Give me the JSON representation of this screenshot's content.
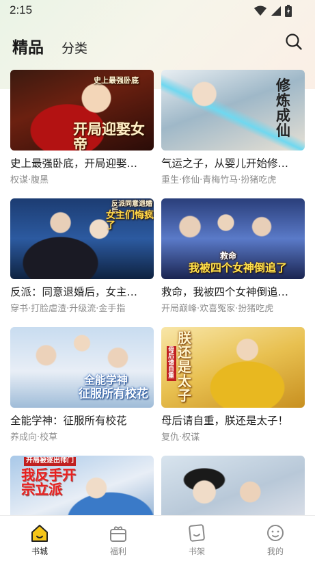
{
  "status_bar": {
    "time": "2:15"
  },
  "header": {
    "tab_active": "精品",
    "tab_inactive": "分类"
  },
  "books": [
    {
      "title": "史上最强卧底，开局迎娶女帝",
      "title_display": "史上最强卧底，开局迎娶…",
      "tags": "权谋·腹黑",
      "cover_text_top": "史上最强卧底",
      "cover_text_main": "开局迎娶女帝"
    },
    {
      "title": "气运之子，从婴儿开始修仙",
      "title_display": "气运之子，从婴儿开始修…",
      "tags": "重生·修仙·青梅竹马·扮猪吃虎",
      "cover_text_main": "修炼成仙"
    },
    {
      "title": "反派：同意退婚后，女主后悔了",
      "title_display": "反派：同意退婚后，女主…",
      "tags": "穿书·打脸虐渣·升级流·金手指",
      "cover_text_top": "反派同意退婚后",
      "cover_text_main": "女主们悔疯了"
    },
    {
      "title": "救命，我被四个女神倒追了",
      "title_display": "救命，我被四个女神倒追…",
      "tags": "开局巅峰·欢喜冤家·扮猪吃虎",
      "cover_text_top": "救命",
      "cover_text_main": "我被四个女神倒追了"
    },
    {
      "title": "全能学神：征服所有校花",
      "title_display": "全能学神：征服所有校花",
      "tags": "养成向·校草",
      "cover_text_top": "全能学神",
      "cover_text_main": "征服所有校花"
    },
    {
      "title": "母后请自重，朕还是太子！",
      "title_display": "母后请自重，朕还是太子！",
      "tags": "复仇·权谋",
      "cover_text_top": "母后请自重",
      "cover_text_main": "朕还是太子"
    },
    {
      "title": "",
      "title_display": "",
      "tags": "",
      "cover_text_top": "开局被逐出师门",
      "cover_text_main": "我反手开宗立派"
    },
    {
      "title": "",
      "title_display": "",
      "tags": "",
      "cover_text_main": ""
    }
  ],
  "nav": [
    {
      "label": "书城",
      "active": true
    },
    {
      "label": "福利",
      "active": false
    },
    {
      "label": "书架",
      "active": false
    },
    {
      "label": "我的",
      "active": false
    }
  ],
  "colors": {
    "accent": "#f5c518",
    "active_text": "#222222",
    "inactive_text": "#8a8a8a"
  }
}
